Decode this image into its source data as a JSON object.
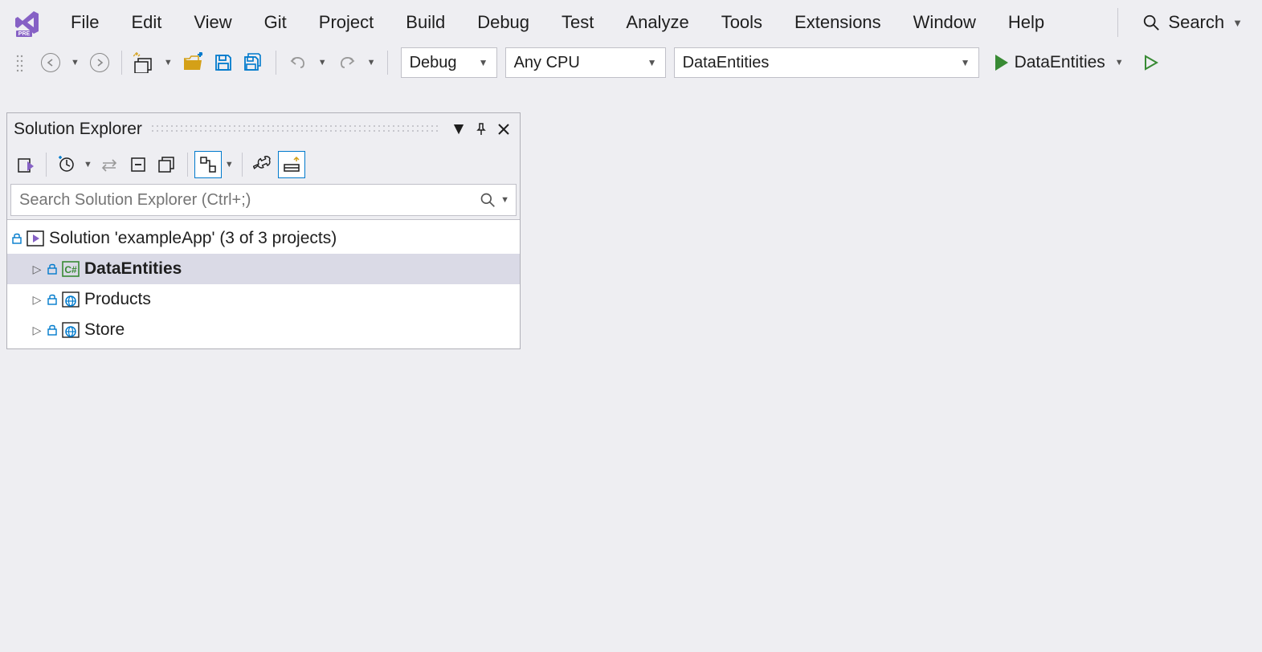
{
  "menu": {
    "items": [
      "File",
      "Edit",
      "View",
      "Git",
      "Project",
      "Build",
      "Debug",
      "Test",
      "Analyze",
      "Tools",
      "Extensions",
      "Window",
      "Help"
    ],
    "search_label": "Search"
  },
  "toolbar": {
    "config_combo": "Debug",
    "platform_combo": "Any CPU",
    "startup_combo": "DataEntities",
    "run_label": "DataEntities"
  },
  "panel": {
    "title": "Solution Explorer",
    "search_placeholder": "Search Solution Explorer (Ctrl+;)"
  },
  "tree": {
    "solution_label": "Solution 'exampleApp' (3 of 3 projects)",
    "projects": [
      {
        "name": "DataEntities",
        "type": "csharp",
        "selected": true,
        "bold": true
      },
      {
        "name": "Products",
        "type": "web",
        "selected": false,
        "bold": false
      },
      {
        "name": "Store",
        "type": "web",
        "selected": false,
        "bold": false
      }
    ]
  }
}
